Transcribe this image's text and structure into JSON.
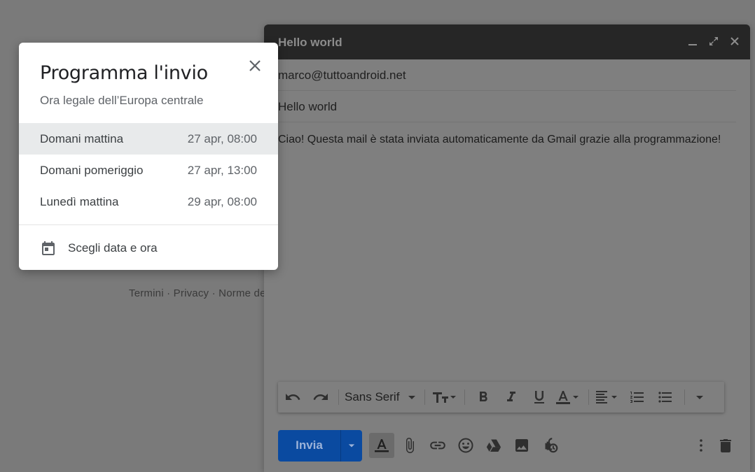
{
  "footer": {
    "links": "Termini · Privacy · Norme de"
  },
  "compose": {
    "title": "Hello world",
    "to": "marco@tuttoandroid.net",
    "subject": "Hello world",
    "body": "Ciao! Questa mail è stata inviata automaticamente da Gmail grazie alla programmazione!",
    "font": "Sans Serif",
    "send_label": "Invia",
    "header_icons": [
      "minimize-icon",
      "expand-icon",
      "close-icon"
    ]
  },
  "schedule": {
    "title": "Programma l'invio",
    "timezone": "Ora legale dell’Europa centrale",
    "options": [
      {
        "label": "Domani mattina",
        "time": "27 apr, 08:00"
      },
      {
        "label": "Domani pomeriggio",
        "time": "27 apr, 13:00"
      },
      {
        "label": "Lunedì mattina",
        "time": "29 apr, 08:00"
      }
    ],
    "custom_label": "Scegli data e ora"
  },
  "colors": {
    "send": "#0a4aa0",
    "header": "#262626",
    "overlay": "#7a7a7a"
  }
}
